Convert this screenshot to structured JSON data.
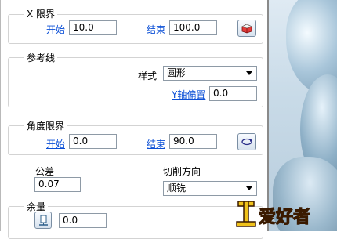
{
  "x_limits": {
    "title": "X 限界",
    "start_label": "开始",
    "start_value": "10.0",
    "end_label": "结束",
    "end_value": "100.0",
    "button_icon": "cut-box-icon"
  },
  "reference_line": {
    "title": "参考线",
    "style_label": "样式",
    "style_value": "圆形",
    "y_offset_label": "Y轴偏置",
    "y_offset_value": "0.0"
  },
  "angle_limits": {
    "title": "角度限界",
    "start_label": "开始",
    "start_value": "0.0",
    "end_label": "结束",
    "end_value": "90.0",
    "button_icon": "rotate-arrow-icon"
  },
  "tolerance": {
    "label": "公差",
    "value": "0.07"
  },
  "cut_direction": {
    "label": "切削方向",
    "value": "顺铣"
  },
  "allowance": {
    "label": "余量",
    "value": "0.0",
    "button_icon": "stock-allowance-icon"
  },
  "watermark": {
    "text": "爱好者"
  }
}
